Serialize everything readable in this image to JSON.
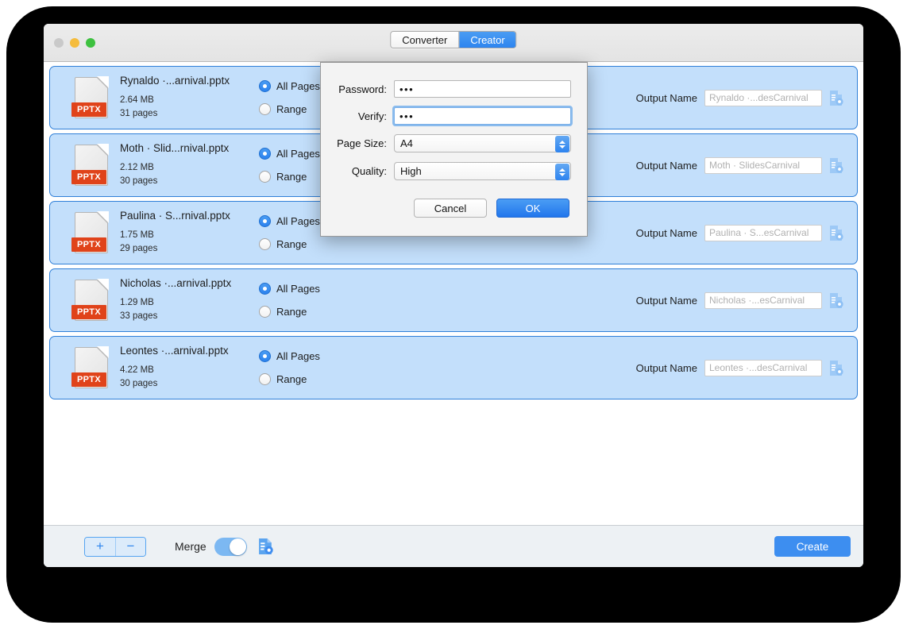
{
  "window": {
    "traffic_lights": [
      "close",
      "minimize",
      "zoom"
    ],
    "tabs": [
      {
        "label": "Converter",
        "active": false
      },
      {
        "label": "Creator",
        "active": true
      }
    ]
  },
  "files": [
    {
      "icon_label": "PPTX",
      "name": "Rynaldo ·...arnival.pptx",
      "size": "2.64 MB",
      "pages": "31 pages",
      "range_options": [
        {
          "label": "All Pages",
          "selected": true
        },
        {
          "label": "Range",
          "selected": false
        }
      ],
      "output_label": "Output Name",
      "output_placeholder": "Rynaldo ·...desCarnival",
      "output_value": ""
    },
    {
      "icon_label": "PPTX",
      "name": "Moth · Slid...rnival.pptx",
      "size": "2.12 MB",
      "pages": "30 pages",
      "range_options": [
        {
          "label": "All Pages",
          "selected": true
        },
        {
          "label": "Range",
          "selected": false
        }
      ],
      "output_label": "Output Name",
      "output_placeholder": "Moth · SlidesCarnival",
      "output_value": ""
    },
    {
      "icon_label": "PPTX",
      "name": "Paulina · S...rnival.pptx",
      "size": "1.75 MB",
      "pages": "29 pages",
      "range_options": [
        {
          "label": "All Pages",
          "selected": true
        },
        {
          "label": "Range",
          "selected": false
        }
      ],
      "output_label": "Output Name",
      "output_placeholder": "Paulina · S...esCarnival",
      "output_value": ""
    },
    {
      "icon_label": "PPTX",
      "name": "Nicholas ·...arnival.pptx",
      "size": "1.29 MB",
      "pages": "33 pages",
      "range_options": [
        {
          "label": "All Pages",
          "selected": true
        },
        {
          "label": "Range",
          "selected": false
        }
      ],
      "output_label": "Output Name",
      "output_placeholder": "Nicholas ·...esCarnival",
      "output_value": ""
    },
    {
      "icon_label": "PPTX",
      "name": "Leontes ·...arnival.pptx",
      "size": "4.22 MB",
      "pages": "30 pages",
      "range_options": [
        {
          "label": "All Pages",
          "selected": true
        },
        {
          "label": "Range",
          "selected": false
        }
      ],
      "output_label": "Output Name",
      "output_placeholder": "Leontes ·...desCarnival",
      "output_value": ""
    }
  ],
  "toolbar": {
    "add_label": "+",
    "remove_label": "−",
    "merge_label": "Merge",
    "merge_on": true,
    "settings_icon": "document-gear-icon",
    "create_label": "Create"
  },
  "dialog": {
    "fields": [
      {
        "label": "Password:",
        "value": "•••",
        "focused": false
      },
      {
        "label": "Verify:",
        "value": "•••",
        "focused": true
      }
    ],
    "page_size": {
      "label": "Page Size:",
      "value": "A4"
    },
    "quality": {
      "label": "Quality:",
      "value": "High"
    },
    "cancel_label": "Cancel",
    "ok_label": "OK"
  },
  "colors": {
    "accent": "#2e85ef",
    "row_bg": "#c3dffb",
    "row_border": "#2f7fd8",
    "pptx_badge": "#e0431a",
    "create_btn": "#3d8ef0"
  }
}
